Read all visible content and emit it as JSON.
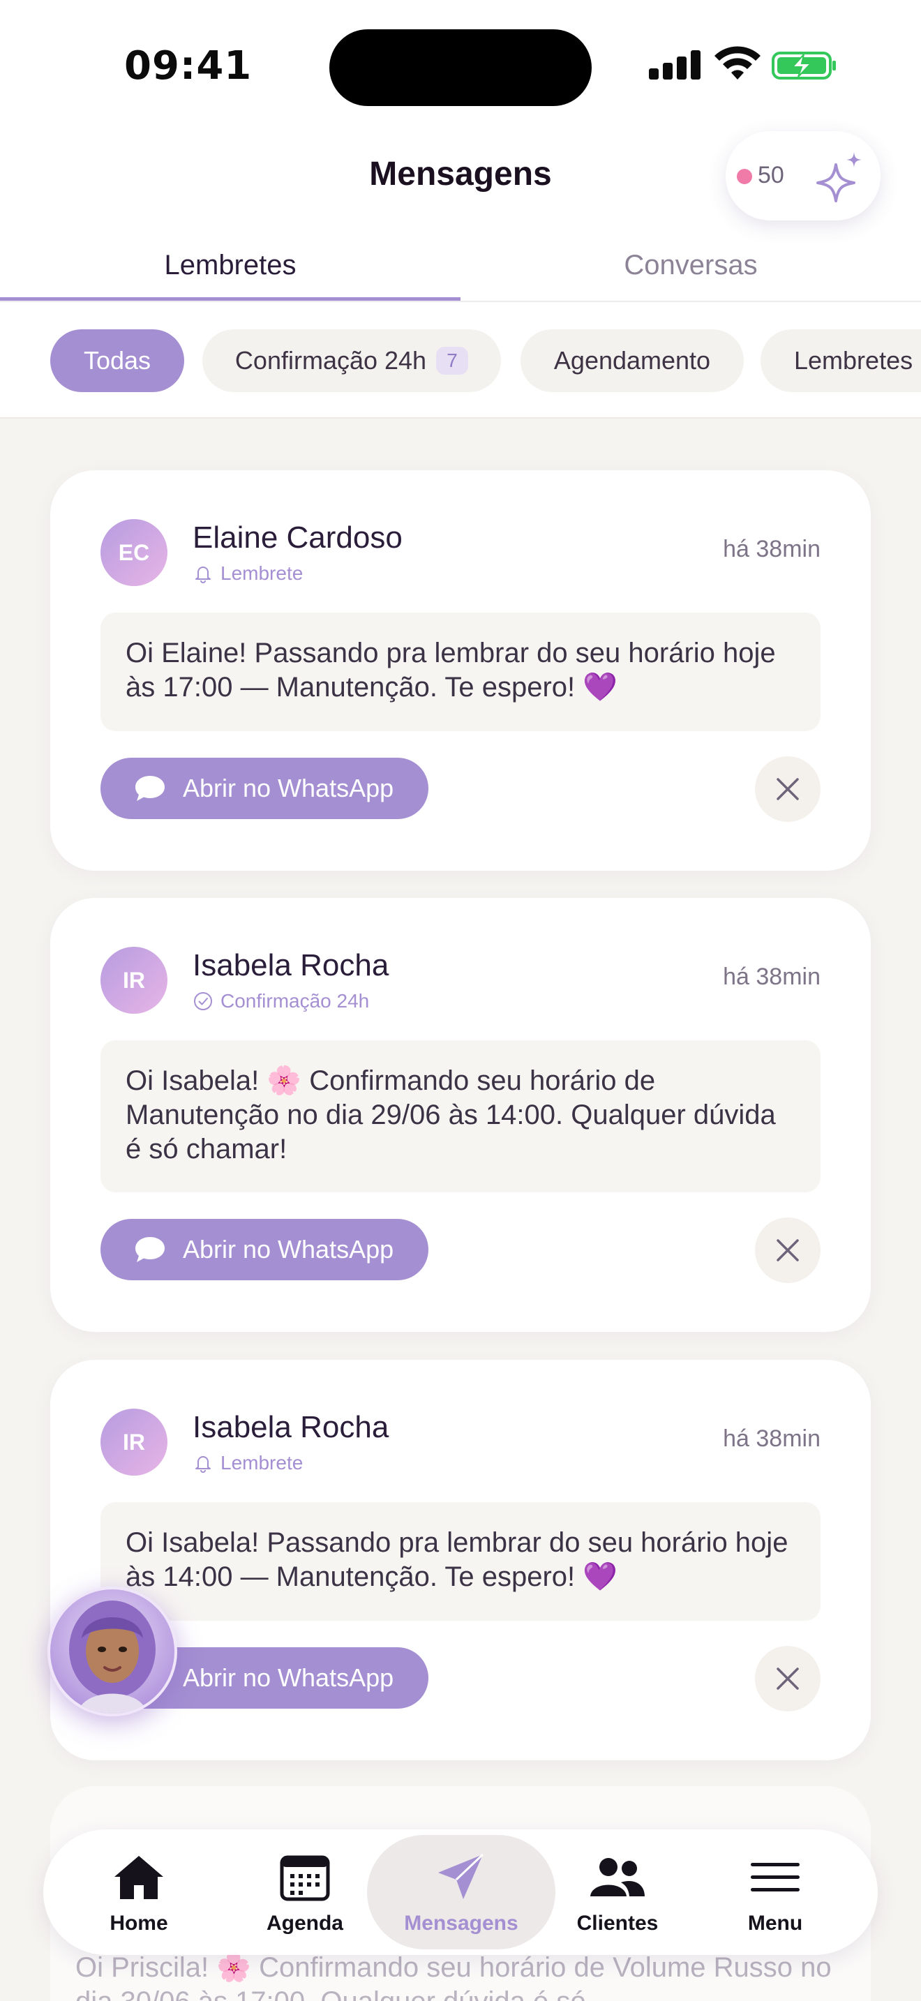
{
  "status_bar": {
    "time": "09:41"
  },
  "header": {
    "title": "Mensagens",
    "credits": "50",
    "accent_color": "#a48fd2",
    "credit_dot_color": "#f07aa8"
  },
  "tabs": [
    {
      "label": "Lembretes",
      "active": true
    },
    {
      "label": "Conversas",
      "active": false
    }
  ],
  "filters": [
    {
      "label": "Todas",
      "active": true
    },
    {
      "label": "Confirmação 24h",
      "badge": "7"
    },
    {
      "label": "Agendamento"
    },
    {
      "label": "Lembretes"
    }
  ],
  "messages": [
    {
      "initials": "EC",
      "name": "Elaine Cardoso",
      "type": "Lembrete",
      "type_icon": "bell-icon",
      "time": "há 38min",
      "text": "Oi Elaine! Passando pra lembrar do seu horário hoje às 17:00 — Manutenção. Te espero! 💜",
      "action": "Abrir no WhatsApp"
    },
    {
      "initials": "IR",
      "name": "Isabela Rocha",
      "type": "Confirmação 24h",
      "type_icon": "check-circle-icon",
      "time": "há 38min",
      "text": "Oi Isabela! 🌸 Confirmando seu horário de Manutenção no dia 29/06 às 14:00. Qualquer dúvida é só chamar!",
      "action": "Abrir no WhatsApp"
    },
    {
      "initials": "IR",
      "name": "Isabela Rocha",
      "type": "Lembrete",
      "type_icon": "bell-icon",
      "time": "há 38min",
      "text": "Oi Isabela! Passando pra lembrar do seu horário hoje às 14:00 — Manutenção. Te espero! 💜",
      "action": "Abrir no WhatsApp"
    }
  ],
  "partial_message": {
    "text": "Oi Priscila! 🌸 Confirmando seu horário de Volume Russo no dia 30/06 às 17:00. Qualquer dúvida é só"
  },
  "bottom_nav": [
    {
      "label": "Home",
      "icon": "home-icon"
    },
    {
      "label": "Agenda",
      "icon": "calendar-icon"
    },
    {
      "label": "Mensagens",
      "icon": "send-icon",
      "active": true
    },
    {
      "label": "Clientes",
      "icon": "users-icon"
    },
    {
      "label": "Menu",
      "icon": "menu-icon"
    }
  ]
}
